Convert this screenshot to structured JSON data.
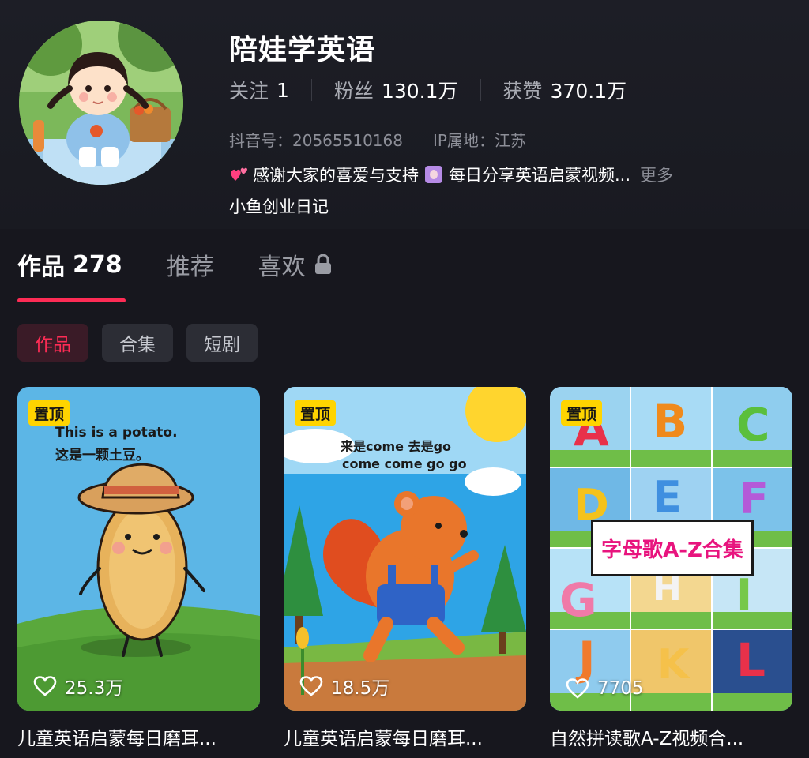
{
  "profile": {
    "name": "陪娃学英语",
    "stats": [
      {
        "label": "关注",
        "value": "1"
      },
      {
        "label": "粉丝",
        "value": "130.1万"
      },
      {
        "label": "获赞",
        "value": "370.1万"
      }
    ],
    "douyin_id": "抖音号：20565510168",
    "ip_location": "IP属地：江苏",
    "bio_part1": "感谢大家的喜爱与支持",
    "bio_part2": "每日分享英语启蒙视频...",
    "bio_more": "更多",
    "bio_line2": "小鱼创业日记"
  },
  "tabs": {
    "works_label": "作品",
    "works_count": "278",
    "recommend_label": "推荐",
    "likes_label": "喜欢"
  },
  "chips": [
    "作品",
    "合集",
    "短剧"
  ],
  "videos": [
    {
      "pinned_label": "置顶",
      "likes": "25.3万",
      "title": "儿童英语启蒙每日磨耳...",
      "overlay_line1": "This is a potato.",
      "overlay_line2": "这是一颗土豆。"
    },
    {
      "pinned_label": "置顶",
      "likes": "18.5万",
      "title": "儿童英语启蒙每日磨耳...",
      "overlay_line1": "来是come 去是go",
      "overlay_line2": "come come go go"
    },
    {
      "pinned_label": "置顶",
      "likes": "7705",
      "title": "自然拼读歌A-Z视频合...",
      "overlay_label": "字母歌A-Z合集",
      "letters": [
        "A",
        "B",
        "C",
        "D",
        "E",
        "F",
        "G",
        "H",
        "I",
        "J",
        "K",
        "L"
      ]
    }
  ],
  "colors": {
    "background": "#17171e",
    "accent": "#fe2c55",
    "pin_badge": "#ffd400"
  }
}
